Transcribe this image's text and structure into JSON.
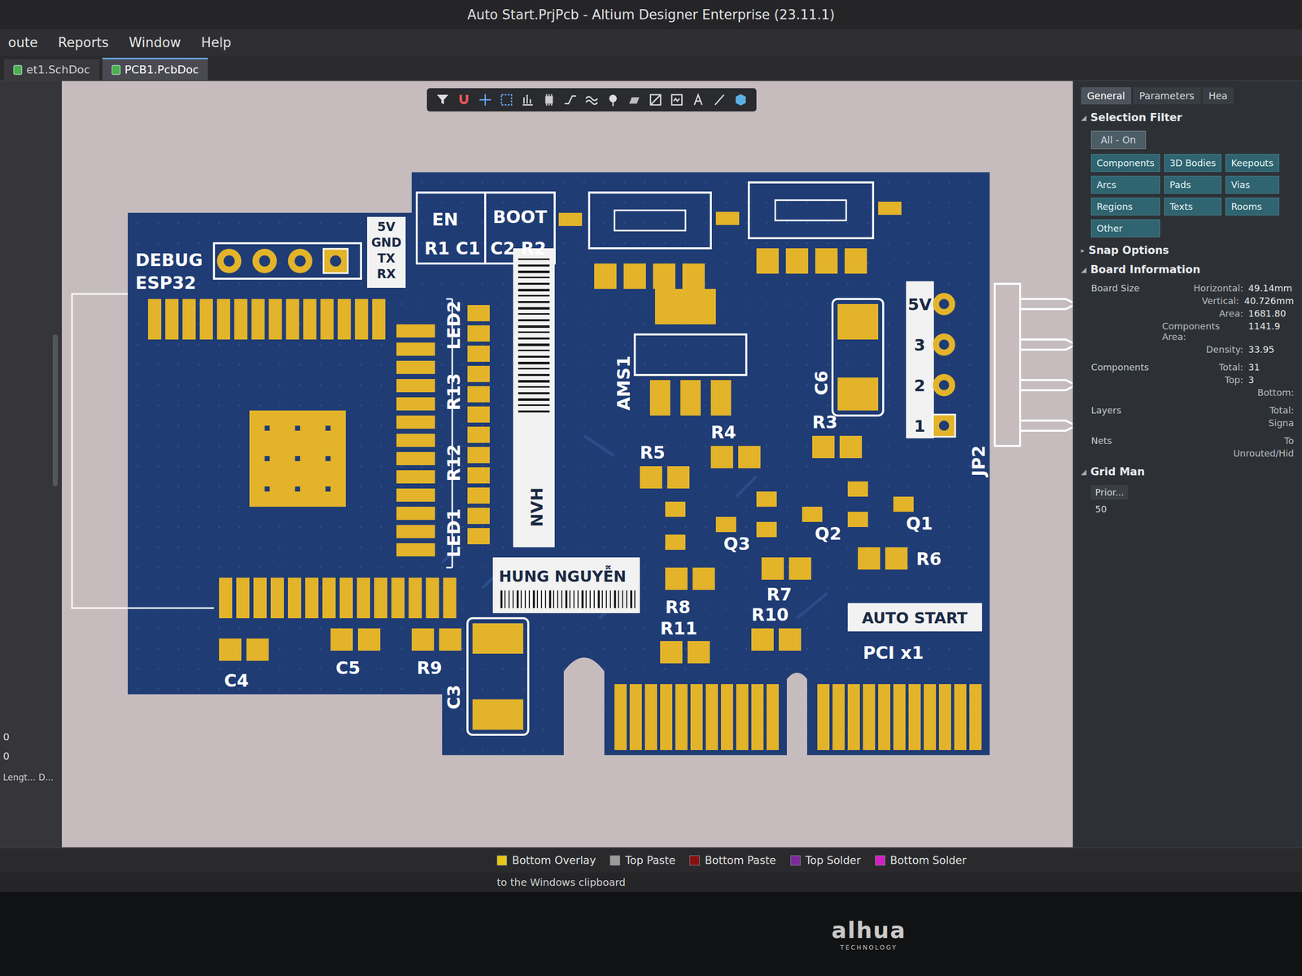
{
  "window": {
    "title": "Auto Start.PrjPcb - Altium Designer Enterprise (23.11.1)"
  },
  "menu": [
    "oute",
    "Reports",
    "Window",
    "Help"
  ],
  "documents": [
    {
      "label": "et1.SchDoc",
      "selected": false
    },
    {
      "label": "PCB1.PcbDoc",
      "selected": true
    }
  ],
  "left_panel": {
    "values": [
      "0",
      "0"
    ],
    "columns": [
      "Lengt...",
      "D..."
    ]
  },
  "board": {
    "labels": [
      "DEBUG",
      "ESP32",
      "EN",
      "BOOT",
      "R1 C1",
      "C2 R2",
      "LED2",
      "R13",
      "R12",
      "LED1",
      "AMS1",
      "C6",
      "JP2",
      "R5",
      "R4",
      "R3",
      "Q3",
      "Q2",
      "Q1",
      "R6",
      "R7",
      "R8",
      "PCI x1",
      "R11",
      "R10",
      "R9",
      "C5",
      "C4",
      "C3"
    ],
    "debug_pins": [
      "5V",
      "GND",
      "TX",
      "RX"
    ],
    "jp2_pins": [
      "5V",
      "3",
      "2",
      "1"
    ],
    "strip_text": "NVH",
    "name_plate": "HUNG NGUYỄN",
    "title_plate": "AUTO START"
  },
  "properties": {
    "tabs": [
      {
        "label": "General",
        "selected": true
      },
      {
        "label": "Parameters",
        "selected": false
      },
      {
        "label": "Hea",
        "selected": false
      }
    ],
    "selection_filter": {
      "title": "Selection Filter",
      "expanded": true,
      "all": "All - On",
      "buttons": [
        {
          "label": "Components",
          "on": true
        },
        {
          "label": "3D Bodies",
          "on": true
        },
        {
          "label": "Keepouts",
          "on": true
        },
        {
          "label": "Arcs",
          "on": true
        },
        {
          "label": "Pads",
          "on": true
        },
        {
          "label": "Vias",
          "on": true
        },
        {
          "label": "Regions",
          "on": true
        },
        {
          "label": "Texts",
          "on": true
        },
        {
          "label": "Rooms",
          "on": true
        },
        {
          "label": "Other",
          "on": true
        }
      ]
    },
    "snap_options": {
      "title": "Snap Options",
      "expanded": false
    },
    "board_information": {
      "title": "Board Information",
      "expanded": true,
      "board_size": {
        "label": "Board Size",
        "rows": [
          {
            "key": "Horizontal:",
            "value": "49.14mm"
          },
          {
            "key": "Vertical:",
            "value": "40.726mm"
          },
          {
            "key": "Area:",
            "value": "1681.80"
          },
          {
            "key": "Components Area:",
            "value": "1141.9"
          },
          {
            "key": "Density:",
            "value": "33.95"
          }
        ]
      },
      "groups": [
        {
          "label": "Components",
          "rows": [
            {
              "key": "Total:",
              "value": "31"
            },
            {
              "key": "Top:",
              "value": "3"
            },
            {
              "key": "Bottom:",
              "value": ""
            }
          ]
        },
        {
          "label": "Layers",
          "rows": [
            {
              "key": "Total:",
              "value": ""
            },
            {
              "key": "Signa",
              "value": ""
            }
          ]
        },
        {
          "label": "Nets",
          "rows": [
            {
              "key": "To",
              "value": ""
            },
            {
              "key": "Unrouted/Hid",
              "value": ""
            }
          ]
        }
      ]
    },
    "grid_manager": {
      "title": "Grid Man",
      "header": "Prior...",
      "value": "50"
    }
  },
  "layers": [
    {
      "label": "Bottom Overlay",
      "color": "#e6c619"
    },
    {
      "label": "Top Paste",
      "color": "#9a9a9a"
    },
    {
      "label": "Bottom Paste",
      "color": "#8a1010"
    },
    {
      "label": "Top Solder",
      "color": "#7a2a9a"
    },
    {
      "label": "Bottom Solder",
      "color": "#d020c0"
    }
  ],
  "status": "to the Windows clipboard",
  "monitor": {
    "brand": "alhua",
    "tagline": "TECHNOLOGY"
  }
}
